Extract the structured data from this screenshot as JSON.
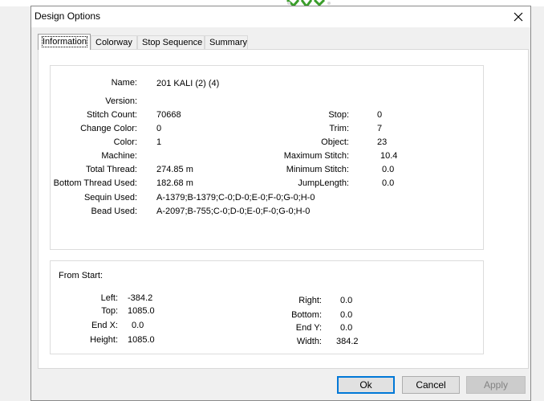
{
  "window": {
    "title": "Design Options"
  },
  "tabs": [
    "Information",
    "Colorway",
    "Stop Sequence",
    "Summary"
  ],
  "info": {
    "left": [
      {
        "label": "Name:",
        "value": "201 KALI (2) (4)"
      },
      {
        "label": "Version:",
        "value": ""
      },
      {
        "label": "Stitch Count:",
        "value": "70668"
      },
      {
        "label": "Change Color:",
        "value": "0"
      },
      {
        "label": "Color:",
        "value": "1"
      },
      {
        "label": "Machine:",
        "value": ""
      },
      {
        "label": "Total Thread:",
        "value": "274.85 m"
      },
      {
        "label": "Bottom Thread Used:",
        "value": "182.68 m"
      },
      {
        "label": "Sequin Used:",
        "value": "A-1379;B-1379;C-0;D-0;E-0;F-0;G-0;H-0"
      },
      {
        "label": "Bead Used:",
        "value": "A-2097;B-755;C-0;D-0;E-0;F-0;G-0;H-0"
      }
    ],
    "right": [
      {
        "label": "Stop:",
        "value": "0"
      },
      {
        "label": "Trim:",
        "value": "7"
      },
      {
        "label": "Object:",
        "value": "23"
      },
      {
        "label": "Maximum Stitch:",
        "value": "10.4"
      },
      {
        "label": "Minimum Stitch:",
        "value": "0.0"
      },
      {
        "label": "JumpLength:",
        "value": "0.0"
      }
    ]
  },
  "from_start": {
    "title": "From Start:",
    "left": [
      {
        "label": "Left:",
        "value": "-384.2"
      },
      {
        "label": "Top:",
        "value": "1085.0"
      },
      {
        "label": "End X:",
        "value": "0.0"
      },
      {
        "label": "Height:",
        "value": "1085.0"
      }
    ],
    "right": [
      {
        "label": "Right:",
        "value": "0.0"
      },
      {
        "label": "Bottom:",
        "value": "0.0"
      },
      {
        "label": "End Y:",
        "value": "0.0"
      },
      {
        "label": "Width:",
        "value": "384.2"
      }
    ]
  },
  "buttons": {
    "ok": "Ok",
    "cancel": "Cancel",
    "apply": "Apply"
  },
  "colors": {
    "accent": "#0078d7",
    "art_green": "#3a9d2a"
  }
}
